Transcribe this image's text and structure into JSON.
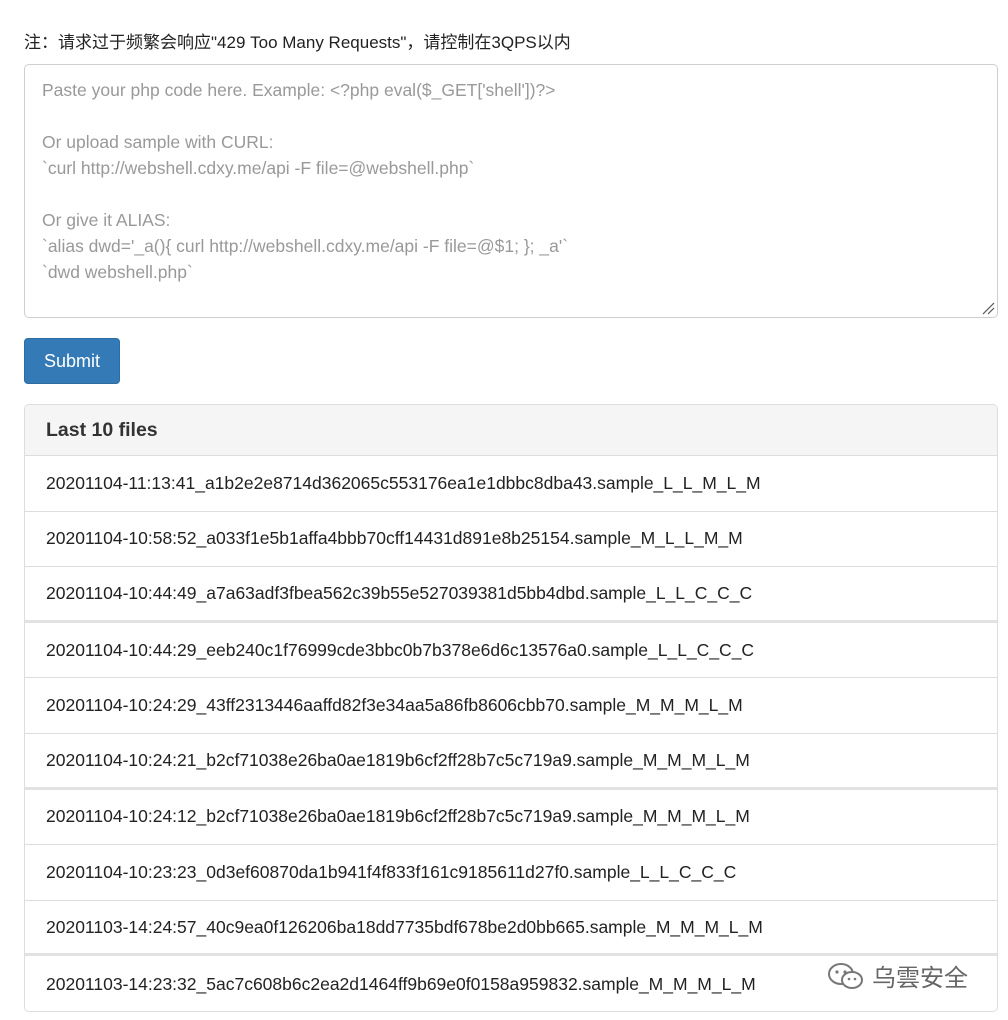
{
  "notice": "注：请求过于频繁会响应\"429 Too Many Requests\"，请控制在3QPS以内",
  "code_input": {
    "placeholder": "Paste your php code here. Example: <?php eval($_GET['shell'])?>\n\nOr upload sample with CURL:\n`curl http://webshell.cdxy.me/api -F file=@webshell.php`\n\nOr give it ALIAS:\n`alias dwd='_a(){ curl http://webshell.cdxy.me/api -F file=@$1; }; _a'`\n`dwd webshell.php`",
    "value": ""
  },
  "submit_label": "Submit",
  "panel": {
    "title": "Last 10 files",
    "files": [
      "20201104-11:13:41_a1b2e2e8714d362065c553176ea1e1dbbc8dba43.sample_L_L_M_L_M",
      "20201104-10:58:52_a033f1e5b1affa4bbb70cff14431d891e8b25154.sample_M_L_L_M_M",
      "20201104-10:44:49_a7a63adf3fbea562c39b55e527039381d5bb4dbd.sample_L_L_C_C_C",
      "20201104-10:44:29_eeb240c1f76999cde3bbc0b7b378e6d6c13576a0.sample_L_L_C_C_C",
      "20201104-10:24:29_43ff2313446aaffd82f3e34aa5a86fb8606cbb70.sample_M_M_M_L_M",
      "20201104-10:24:21_b2cf71038e26ba0ae1819b6cf2ff28b7c5c719a9.sample_M_M_M_L_M",
      "20201104-10:24:12_b2cf71038e26ba0ae1819b6cf2ff28b7c5c719a9.sample_M_M_M_L_M",
      "20201104-10:23:23_0d3ef60870da1b941f4f833f161c9185611d27f0.sample_L_L_C_C_C",
      "20201103-14:24:57_40c9ea0f126206ba18dd7735bdf678be2d0bb665.sample_M_M_M_L_M",
      "20201103-14:23:32_5ac7c608b6c2ea2d1464ff9b69e0f0158a959832.sample_M_M_M_L_M"
    ]
  },
  "watermark": {
    "text": "乌雲安全",
    "icon": "wechat-icon"
  },
  "colors": {
    "primary": "#337ab7",
    "placeholder": "#999999",
    "panel_heading_bg": "#f5f5f5",
    "border": "#dddddd"
  }
}
